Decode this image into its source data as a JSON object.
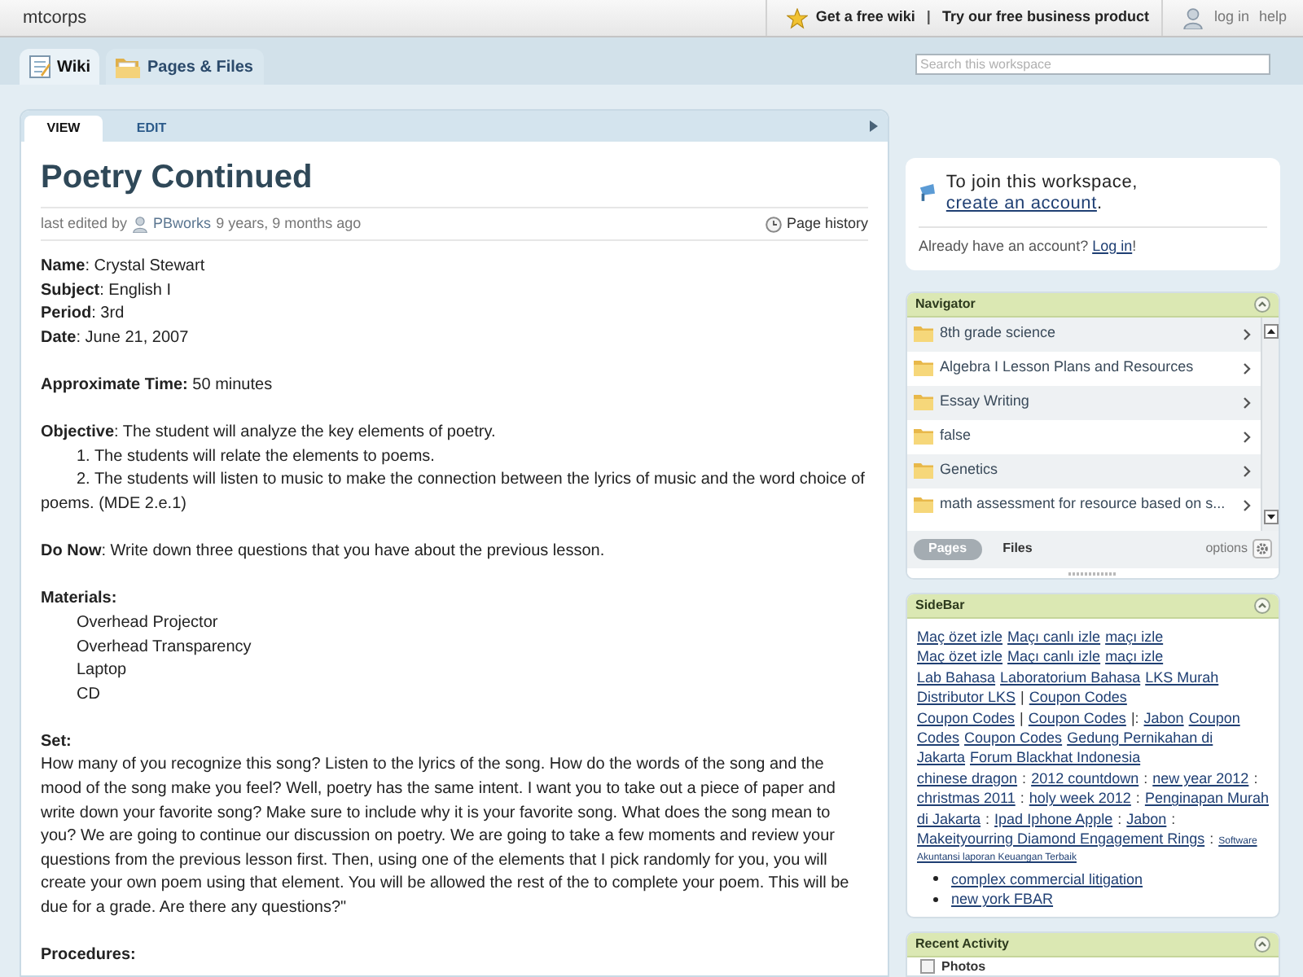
{
  "top_bar": {
    "site_name": "mtcorps",
    "promo_links": [
      "Get a free wiki",
      "Try our free business product"
    ],
    "promo_separator": "|",
    "user_links": [
      "log in",
      "help"
    ]
  },
  "workspace_tabs": [
    {
      "label": "Wiki",
      "selected": true
    },
    {
      "label": "Pages & Files",
      "selected": false
    }
  ],
  "search": {
    "placeholder": "Search this workspace"
  },
  "page": {
    "view_tabs": [
      {
        "label": "VIEW",
        "selected": true
      },
      {
        "label": "EDIT",
        "selected": false
      }
    ],
    "title": "Poetry Continued",
    "meta": {
      "edited_prefix": "last edited by",
      "author": "PBworks",
      "edited_age": "9 years, 9 months ago",
      "history_link": "Page history"
    },
    "sections": [
      {
        "lines": [
          {
            "kind": "field",
            "text": "**Name**: Crystal Stewart"
          },
          {
            "kind": "field",
            "text": "**Subject**: English I"
          },
          {
            "kind": "field",
            "text": "**Period**: 3rd"
          },
          {
            "kind": "field",
            "text": "**Date**: June 21, 2007"
          }
        ]
      },
      {
        "lines": [
          {
            "kind": "field",
            "text": "**Approximate Time:** 50 minutes"
          }
        ]
      },
      {
        "lines": [
          {
            "kind": "field",
            "text": "**Objective**: The student will analyze the key elements of poetry."
          },
          {
            "kind": "numbered",
            "text": "1. The students will relate the elements to poems."
          },
          {
            "kind": "numbered",
            "text": "2. The students will listen to music to make the connection between the lyrics of music and the word choice of poems. (MDE 2.e.1)"
          }
        ]
      },
      {
        "lines": [
          {
            "kind": "field",
            "text": "**Do Now**: Write down three questions that you have about the previous lesson."
          }
        ]
      },
      {
        "lines": [
          {
            "kind": "heading",
            "text": "Materials:"
          },
          {
            "kind": "material",
            "text": "Overhead Projector"
          },
          {
            "kind": "material",
            "text": "Overhead Transparency"
          },
          {
            "kind": "material",
            "text": "Laptop"
          },
          {
            "kind": "material",
            "text": "CD"
          }
        ]
      },
      {
        "lines": [
          {
            "kind": "heading",
            "text": "Set:"
          },
          {
            "kind": "paragraph",
            "text": "How many of you recognize this song? Listen to the lyrics of the song. How do the words of the song and the mood of the song make you feel? Well, poetry has the same intent. I want you to take out a piece of paper and write down your favorite song? Make sure to include why it is your favorite song. What does the song mean to you? We are going to continue our discussion on poetry. We are going to take a few moments and review your questions from the previous lesson first. Then, using one of the elements that I pick randomly for you, you will create your own poem using that element. You will be allowed the rest of the to complete your poem. This will be due for a grade. Are there any questions?\""
          }
        ]
      },
      {
        "lines": [
          {
            "kind": "heading",
            "text": "Procedures:"
          }
        ]
      }
    ]
  },
  "join_card": {
    "prompt": "To join this workspace, ",
    "link": "create an account",
    "prompt_end": ".",
    "login_prompt": "Already have an account? ",
    "login_link": "Log in",
    "login_end": "!"
  },
  "navigator": {
    "title": "Navigator",
    "items": [
      "8th grade science",
      "Algebra I Lesson Plans and Resources",
      "Essay Writing",
      "false",
      "Genetics",
      "math assessment for resource based on s..."
    ],
    "tabs": [
      {
        "label": "Pages",
        "selected": true
      },
      {
        "label": "Files",
        "selected": false
      }
    ],
    "options_label": "options"
  },
  "sidebar": {
    "title": "SideBar",
    "lines": [
      [
        {
          "kind": "link",
          "text": "Maç özet izle"
        },
        {
          "kind": "link",
          "text": "Maçı canlı izle"
        },
        {
          "kind": "link",
          "text": "maçı izle"
        }
      ],
      [
        {
          "kind": "link",
          "text": "Maç özet izle"
        },
        {
          "kind": "link",
          "text": "Maçı canlı izle"
        },
        {
          "kind": "link",
          "text": "maçı izle"
        }
      ],
      [
        {
          "kind": "link",
          "text": "Lab Bahasa"
        },
        {
          "kind": "link",
          "text": "Laboratorium Bahasa"
        },
        {
          "kind": "link",
          "text": "LKS Murah"
        }
      ],
      [
        {
          "kind": "link",
          "text": "Distributor LKS"
        },
        {
          "kind": "text",
          "text": "|"
        },
        {
          "kind": "link",
          "text": "Coupon Codes"
        }
      ],
      [
        {
          "kind": "link",
          "text": "Coupon Codes"
        },
        {
          "kind": "text",
          "text": "|"
        },
        {
          "kind": "link",
          "text": "Coupon Codes"
        },
        {
          "kind": "text",
          "text": "|:"
        },
        {
          "kind": "link",
          "text": "Jabon"
        },
        {
          "kind": "link",
          "text": "Coupon"
        }
      ],
      [
        {
          "kind": "link",
          "text": "Codes"
        },
        {
          "kind": "link",
          "text": "Coupon Codes"
        },
        {
          "kind": "link",
          "text": "Gedung Pernikahan di"
        }
      ],
      [
        {
          "kind": "link",
          "text": "Jakarta"
        },
        {
          "kind": "link",
          "text": "Forum Blackhat Indonesia"
        }
      ],
      [
        {
          "kind": "link",
          "text": "chinese dragon"
        },
        {
          "kind": "text",
          "text": ":"
        },
        {
          "kind": "link",
          "text": "2012 countdown"
        },
        {
          "kind": "text",
          "text": ":"
        },
        {
          "kind": "link",
          "text": "new year 2012"
        },
        {
          "kind": "text",
          "text": ":"
        }
      ],
      [
        {
          "kind": "link",
          "text": "christmas 2011"
        },
        {
          "kind": "text",
          "text": ":"
        },
        {
          "kind": "link",
          "text": "holy week 2012"
        },
        {
          "kind": "text",
          "text": ":"
        },
        {
          "kind": "link",
          "text": "Penginapan Murah"
        }
      ],
      [
        {
          "kind": "link",
          "text": "di Jakarta"
        },
        {
          "kind": "text",
          "text": ":"
        },
        {
          "kind": "link",
          "text": "Ipad Iphone Apple"
        },
        {
          "kind": "text",
          "text": ":"
        },
        {
          "kind": "link",
          "text": "Jabon"
        },
        {
          "kind": "text",
          "text": ":"
        }
      ],
      [
        {
          "kind": "link",
          "text": "Makeityourring Diamond Engagement Rings"
        },
        {
          "kind": "text",
          "text": ":"
        },
        {
          "kind": "small_link",
          "text": "Software"
        }
      ],
      [
        {
          "kind": "small_link",
          "text": "Akuntansi laporan Keuangan Terbaik"
        }
      ]
    ],
    "bullets": [
      "complex commercial litigation",
      "new york FBAR"
    ]
  },
  "recent_activity": {
    "title": "Recent Activity",
    "items": [
      "Photos"
    ]
  }
}
